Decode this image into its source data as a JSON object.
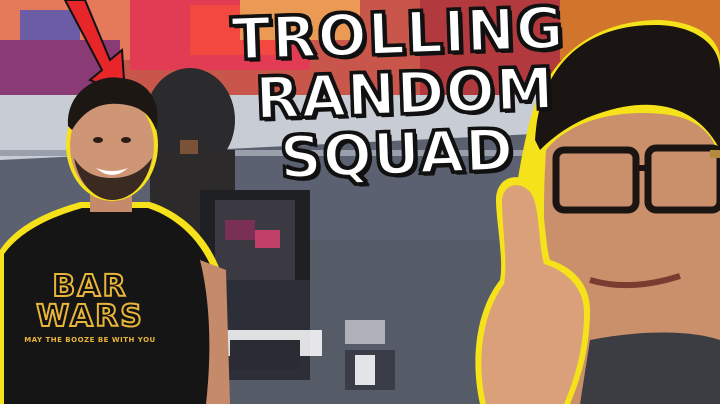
{
  "thumbnail": {
    "title_lines": [
      "TROLLING",
      "RANDOM",
      "SQUAD"
    ],
    "shirt": {
      "line1": "BAR",
      "line2": "WARS",
      "tagline": "MAY THE BOOZE BE WITH YOU"
    }
  },
  "colors": {
    "title_fill": "#ffffff",
    "title_outline": "#111111",
    "outline_yellow": "#f5e21a",
    "arrow_red": "#e8262a",
    "shirt_print": "#e9b43a"
  },
  "icons": {
    "arrow": "red-arrow-icon"
  }
}
